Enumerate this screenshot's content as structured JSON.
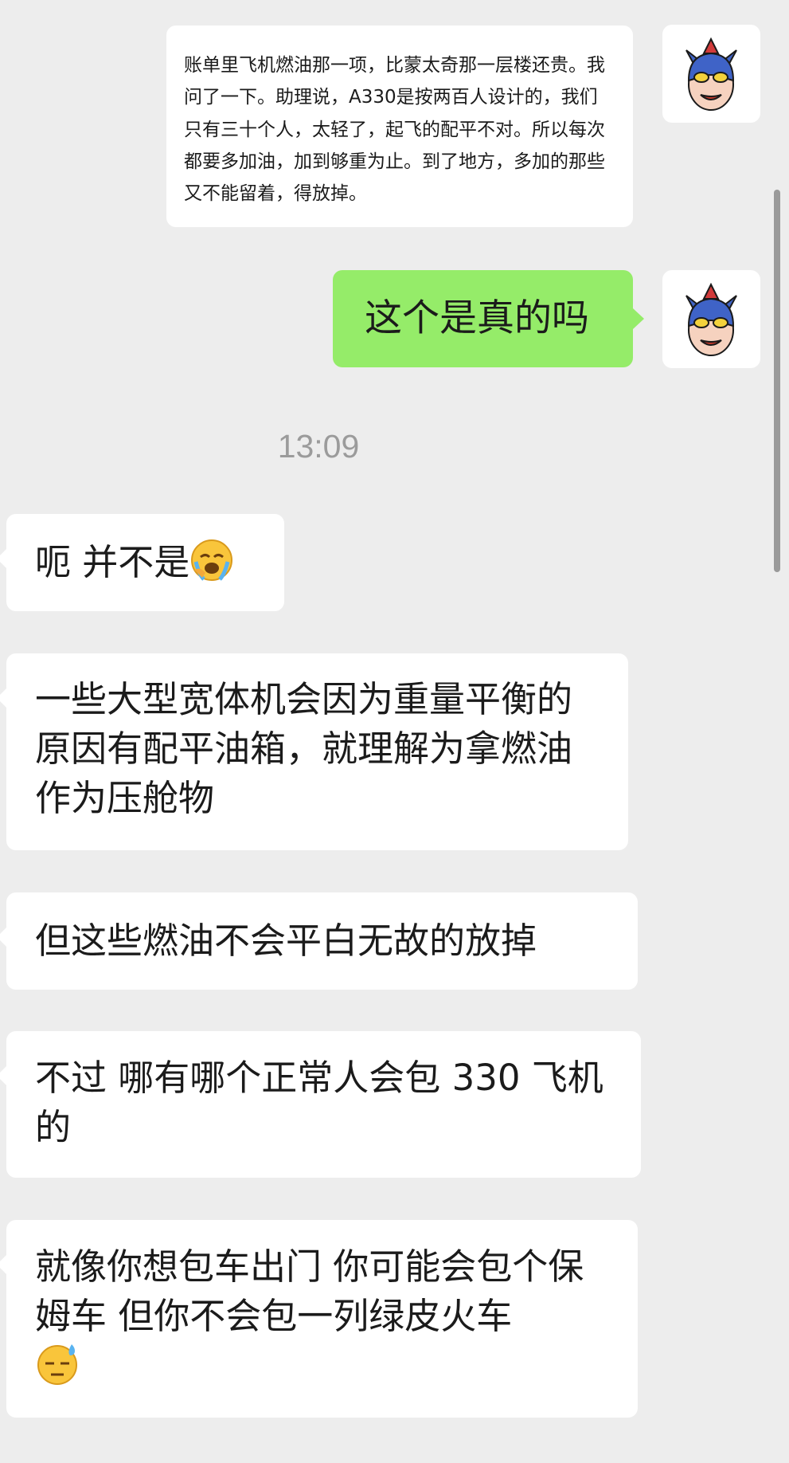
{
  "chat": {
    "messages": [
      {
        "id": "m1",
        "side": "right",
        "text": "账单里飞机燃油那一项，比蒙太奇那一层楼还贵。我问了一下。助理说，A330是按两百人设计的，我们只有三十个人，太轻了，起飞的配平不对。所以每次都要多加油，加到够重为止。到了地方，多加的那些又不能留着，得放掉。"
      },
      {
        "id": "m2",
        "side": "right",
        "text": "这个是真的吗"
      },
      {
        "id": "m3",
        "side": "left",
        "text": "呃 并不是",
        "emoji": "face-with-tears-emoji"
      },
      {
        "id": "m4",
        "side": "left",
        "text": "一些大型宽体机会因为重量平衡的原因有配平油箱，就理解为拿燃油作为压舱物"
      },
      {
        "id": "m5",
        "side": "left",
        "text": "但这些燃油不会平白无故的放掉"
      },
      {
        "id": "m6",
        "side": "left",
        "text": "不过 哪有哪个正常人会包 330 飞机的"
      },
      {
        "id": "m7",
        "side": "left",
        "text": "就像你想包车出门 你可能会包个保姆车 但你不会包一列绿皮火车",
        "emoji": "downcast-sweat-emoji"
      }
    ],
    "timestamp": "13:09"
  },
  "colors": {
    "background": "#ededed",
    "bubble_self": "#95ec69",
    "bubble_other": "#ffffff",
    "timestamp": "#9b9b9b"
  },
  "icons": {
    "avatar": "masked-hero-avatar-icon"
  }
}
